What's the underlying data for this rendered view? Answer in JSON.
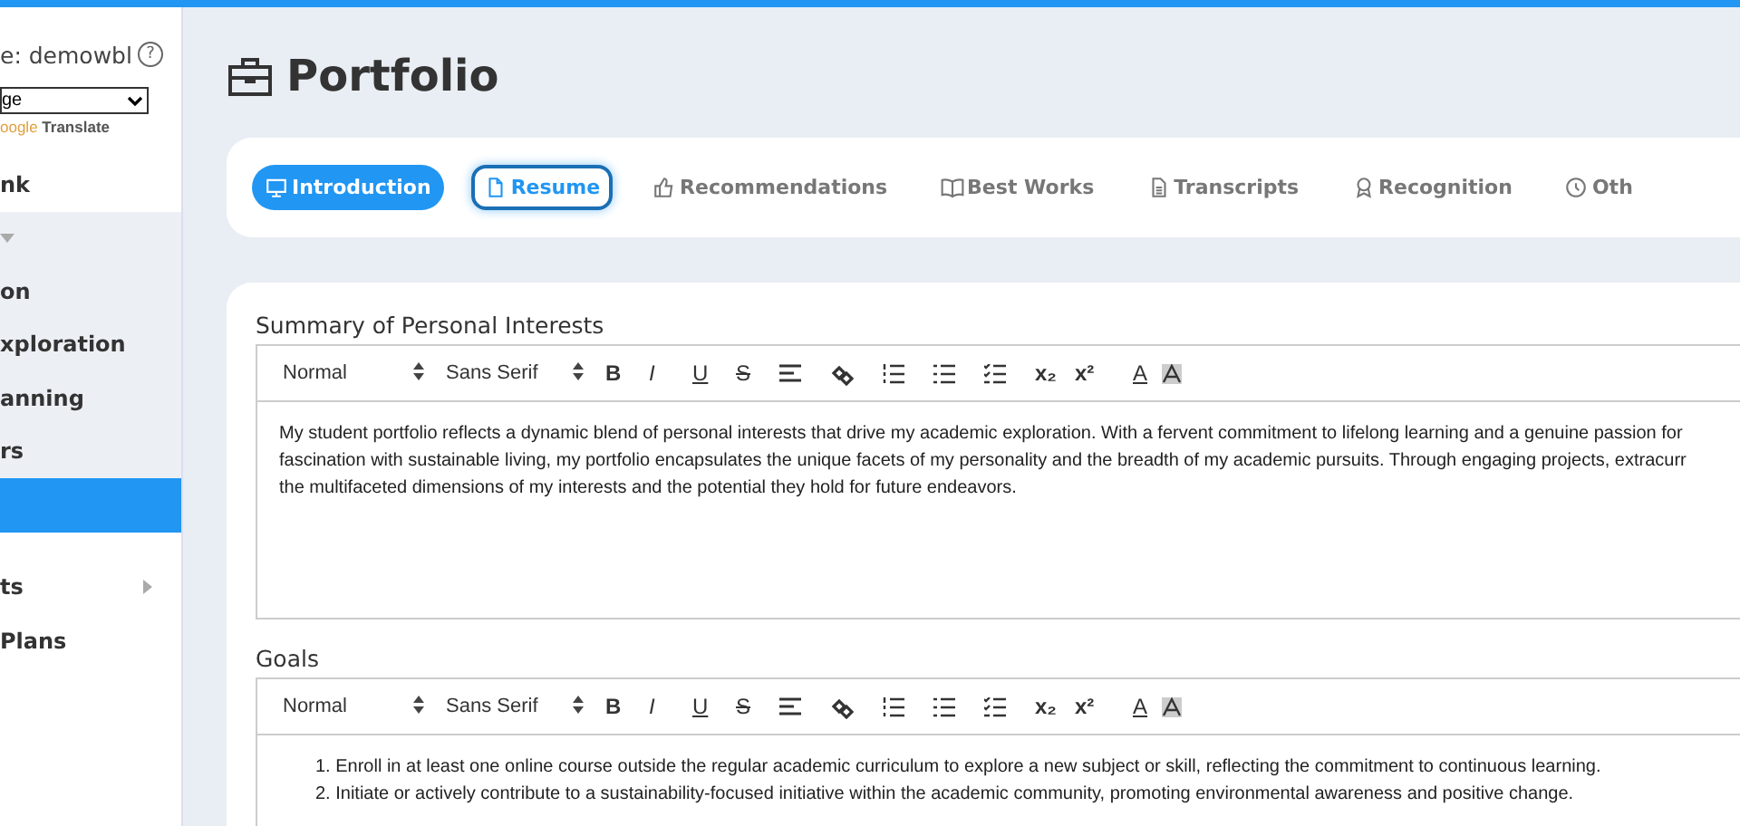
{
  "sidebar": {
    "username": "e: demowbl",
    "help": "?",
    "language_select": "ge",
    "translate": {
      "brand": "oogle",
      "label": "Translate"
    },
    "items": [
      {
        "label": "nk",
        "kind": "link",
        "group": false,
        "selected": false
      },
      {
        "kind": "collapsible",
        "group": true,
        "selected": false
      },
      {
        "label": "on",
        "kind": "link",
        "group": true,
        "selected": false
      },
      {
        "label": "xploration",
        "kind": "link",
        "group": true,
        "selected": false
      },
      {
        "label": "anning",
        "kind": "link",
        "group": true,
        "selected": false
      },
      {
        "label": "rs",
        "kind": "link",
        "group": true,
        "selected": false
      },
      {
        "kind": "link",
        "group": false,
        "selected": true
      },
      {
        "label": "ts",
        "kind": "submenu",
        "group": false,
        "selected": false
      },
      {
        "label": "Plans",
        "kind": "link",
        "group": false,
        "selected": false
      }
    ]
  },
  "page_title": "Portfolio",
  "tabs": [
    {
      "label": "Introduction",
      "selected": true,
      "focused": false
    },
    {
      "label": "Resume",
      "selected": false,
      "focused": true
    },
    {
      "label": "Recommendations",
      "selected": false,
      "focused": false
    },
    {
      "label": "Best Works",
      "selected": false,
      "focused": false
    },
    {
      "label": "Transcripts",
      "selected": false,
      "focused": false
    },
    {
      "label": "Recognition",
      "selected": false,
      "focused": false
    },
    {
      "label": "Oth",
      "selected": false,
      "focused": false
    }
  ],
  "editors": [
    {
      "label": "Summary of Personal Interests",
      "toolbar": {
        "format": "Normal",
        "font": "Sans Serif",
        "buttons": [
          "B",
          "I",
          "U",
          "S",
          "x₂",
          "x²",
          "A"
        ]
      },
      "kind": "paragraph",
      "lines": [
        {
          "text": "My student portfolio reflects a dynamic blend of personal interests that drive my academic exploration. With a fervent commitment to lifelong learning and a genuine passion for"
        },
        {
          "text": "fascination with sustainable living, my portfolio encapsulates the unique facets of my personality and the breadth of my academic pursuits. Through engaging projects, extracurr"
        },
        {
          "text": "the multifaceted dimensions of my interests and the potential they hold for future endeavors."
        }
      ]
    },
    {
      "label": "Goals",
      "toolbar": {
        "format": "Normal",
        "font": "Sans Serif",
        "buttons": [
          "B",
          "I",
          "U",
          "S",
          "x₂",
          "x²",
          "A"
        ]
      },
      "kind": "numbered",
      "lines": [
        {
          "number": "1.",
          "text": "Enroll in at least one online course outside the regular academic curriculum to explore a new subject or skill, reflecting the commitment to continuous learning."
        },
        {
          "number": "2.",
          "text": "Initiate or actively contribute to a sustainability-focused initiative within the academic community, promoting environmental awareness and positive change."
        }
      ]
    }
  ]
}
